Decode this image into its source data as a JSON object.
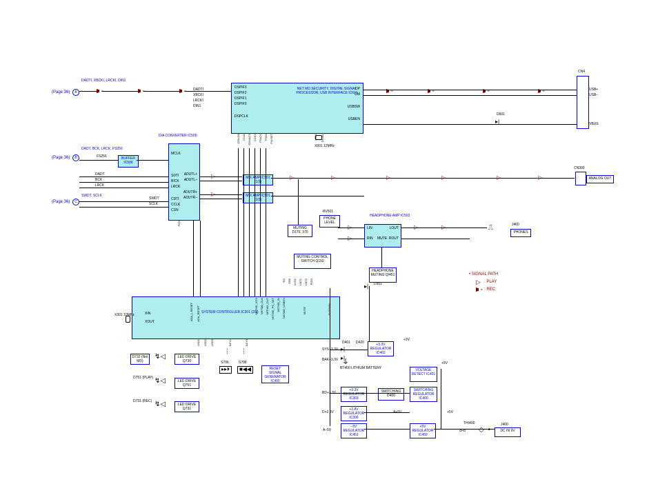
{
  "page_refs": {
    "a": {
      "page": "(Page 36)",
      "signals": "DADTI, XBCKI,\nLRCKI, DIN1"
    },
    "b": {
      "page": "(Page 36)",
      "signals": "DADT, BCK,\nLRCK, FS256"
    },
    "c": {
      "page": "(Page 36)",
      "signals": "SWDT, SCLK"
    }
  },
  "blocks": {
    "dsp": {
      "title": "NET MD SECURITY,\nDIGITAL SIGNAL PROCESSOR,\nUSB INTERFACE\nIC601"
    },
    "buffer": {
      "title": "BUFFER\nIC506"
    },
    "dac": {
      "title": "D/A CONVERTER\nIC505"
    },
    "mixamp1": {
      "title": "MIX AMP\nIC501 (1/2)"
    },
    "mixamp2": {
      "title": "MIX AMP\nIC501 (2/2)"
    },
    "muting_d370": {
      "title": "MUTING\nD170, 370"
    },
    "phone_level": {
      "title": "PHONE\nLEVEL"
    },
    "headphone_amp": {
      "title": "HEADPHONE AMP\nIC503"
    },
    "muting_switch": {
      "title": "MUTING\nCONTROL SWITCH\nQ150"
    },
    "headphone_muting": {
      "title": "HEADPHONE\nMUTING\nQ/451"
    },
    "syscon": {
      "title": "SYSTEM CONTROLLER\nIC301 (2/2)"
    },
    "reset_gen": {
      "title": "RESET\nSIGNAL\nGENERATOR\nIC400"
    },
    "reg33_1": {
      "title": "+3.3V\nREGULATOR\nIC402"
    },
    "reg33_2": {
      "title": "+3.3V\nREGULATOR\nIC303"
    },
    "reg28": {
      "title": "+2.8V\nREGULATOR\nIC306"
    },
    "regm5": {
      "title": "–5V\nREGULATOR\nIC451"
    },
    "regp5": {
      "title": "+5V\nREGULATOR\nIC450"
    },
    "switching": {
      "title": "SWITCHING\nD400"
    },
    "sw_reg": {
      "title": "SWITCHING\nREGULATOR\nIC400"
    },
    "volt_detect": {
      "title": "VOLTAGE\nDETECT\nIC401"
    },
    "led730": {
      "title": "LED DRIVE\nQ730"
    },
    "led751": {
      "title": "LED DRIVE\nQ751"
    },
    "led731": {
      "title": "LED DRIVE\nQ731"
    },
    "d732_label": "D732\n(Net MD)",
    "d751_label": "D751\n(PLAY)",
    "d731_label": "D731\n(REC)",
    "battery": "BT400\nLITHIUM\nBATTERY"
  },
  "connectors": {
    "cn4": {
      "name": "CN4",
      "pins": [
        "USB+",
        "USB–",
        "",
        "VBUS"
      ]
    },
    "cn300": {
      "name": "CN300",
      "pin": "ANALOG OUT"
    },
    "j460": {
      "name": "J460",
      "pin": "PHONES"
    },
    "j400": {
      "name": "J400",
      "pin": "DC IN 9V"
    }
  },
  "misc": {
    "x601": "X601\n12MHz",
    "x301": "X301\n10MHz",
    "d601": "D601",
    "d301": "D301",
    "d401": "D401",
    "d420": "D420",
    "fs256": "FS256",
    "rv501": "RV501",
    "th400": "TH/400",
    "s706": "S706",
    "s708": "S708",
    "th400_arrow_label": ""
  },
  "dsp_pins_left": [
    "DADTI",
    "XBCKI",
    "LRCKI",
    "DIN1"
  ],
  "dsp_in_labels": [
    "DSPIF3",
    "DSPIF2",
    "DSPIF1",
    "DSPIF0",
    "DSPCLK"
  ],
  "dsp_pins_right": [
    "DP",
    "DM",
    "",
    "USBSW",
    "",
    "USBEN"
  ],
  "dsp_pins_bottom": [
    "CDILO0",
    "CN11",
    "CDNACS",
    "CCKX",
    "FS1CK",
    "FS0X",
    "PLLSET",
    "XTAL",
    "D0TAL"
  ],
  "dac_pins_left": [
    "SDTI",
    "BICK",
    "LRCK",
    "",
    "CDTI",
    "CCLK",
    "CSN"
  ],
  "dac_pins_side": [
    "MCLK"
  ],
  "dac_pins_right": [
    "ADUTL+",
    "ADUTL–",
    "",
    "ADUTR+",
    "ADUTR–"
  ],
  "dac_pins_bottom": [
    "PDN"
  ],
  "input_signals": [
    "DADT",
    "BCK",
    "LRCK",
    "",
    "SWDT",
    "SCLK"
  ],
  "syscon_pins_left": [
    "XIN",
    "XOUT"
  ],
  "syscon_pins_left2": [
    "ADA_L.RESET",
    "ADA_RESET"
  ],
  "syscon_pins_bottom": [
    "LED1",
    "LED2",
    "LED3",
    "",
    "KEY1",
    "",
    "KEY0"
  ],
  "syscon_pins_right_vert": [
    "NETMD_XCS",
    "NETMD_CLK",
    "NETMD_OUT",
    "NETMD_PS_SET",
    "NETMD_IN",
    "NETMD_USBEN"
  ],
  "syscon_pins_right2": [
    "MUTE",
    "P. DOWN"
  ],
  "syscon_pins_mid": [
    "RX",
    "SSB",
    "LVCK",
    "LMT1",
    "LMT2",
    "PDIS"
  ],
  "headphone_pins": {
    "lin": "LIN",
    "lout": "LOUT",
    "rin": "RIN",
    "rout": "ROUT",
    "mute": "MUTE"
  },
  "power_labels": {
    "sys33": "SYS+3.3V",
    "bak33": "BAK+3.3V",
    "bd33": "BD+3.3V",
    "d28": "D+2.8V",
    "am5": "A–5V",
    "ap5": "A+5V",
    "p3v": "+3V",
    "p5v": "+5V",
    "p9v": "+9V"
  },
  "legend": {
    "title": "• SIGNAL PATH",
    "play": " : PLAY",
    "rec": " : REC"
  }
}
